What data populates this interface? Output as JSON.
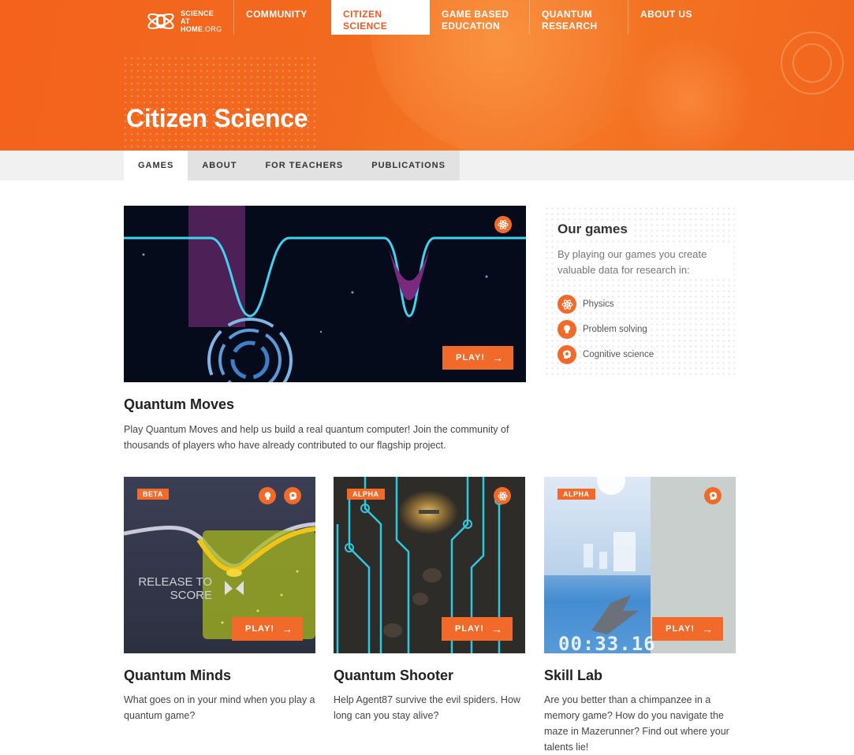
{
  "brand": {
    "logo_line1": "SCIENCE",
    "logo_line2": "AT",
    "logo_line3": "HOME",
    "logo_line3_suffix": ".ORG",
    "accent": "#f26a2a"
  },
  "nav": {
    "items": [
      {
        "line1": "COMMUNITY",
        "line2": ""
      },
      {
        "line1": "CITIZEN",
        "line2": "SCIENCE"
      },
      {
        "line1": "GAME BASED",
        "line2": "EDUCATION"
      },
      {
        "line1": "QUANTUM",
        "line2": "RESEARCH"
      },
      {
        "line1": "ABOUT US",
        "line2": ""
      }
    ],
    "active_index": 1
  },
  "page": {
    "title": "Citizen Science"
  },
  "subnav": {
    "items": [
      "GAMES",
      "ABOUT",
      "FOR TEACHERS",
      "PUBLICATIONS"
    ],
    "active": "GAMES"
  },
  "featured": {
    "title": "Quantum Moves",
    "description": "Play Quantum Moves and help us build a real quantum computer! Join the community of thousands of players who have already contributed to our flagship project.",
    "play_label": "PLAY!",
    "icon": "atom-icon"
  },
  "sidebar": {
    "title": "Our games",
    "description": "By playing our games you create valuable data for research in:",
    "categories": [
      {
        "label": "Physics",
        "icon": "atom-icon"
      },
      {
        "label": "Problem solving",
        "icon": "lightbulb-icon"
      },
      {
        "label": "Cognitive science",
        "icon": "head-icon"
      }
    ]
  },
  "games": [
    {
      "title": "Quantum Minds",
      "description": "What goes on in your mind when you play a quantum game?",
      "tag": "BETA",
      "play_label": "PLAY!",
      "overlay_text_1": "RELEASE TO",
      "overlay_text_2": "SCORE",
      "icons": [
        "lightbulb-icon",
        "head-icon"
      ]
    },
    {
      "title": "Quantum Shooter",
      "description": "Help Agent87 survive the evil spiders. How long can you stay alive?",
      "tag": "ALPHA",
      "play_label": "PLAY!",
      "icons": [
        "atom-icon"
      ]
    },
    {
      "title": "Skill Lab",
      "description": "Are you better than a chimpanzee in a memory game? How do you navigate the maze in Mazerunner? Find out where your talents lie!",
      "tag": "ALPHA",
      "play_label": "PLAY!",
      "overlay_text_1": "00:33.16",
      "icons": [
        "head-icon"
      ]
    }
  ]
}
